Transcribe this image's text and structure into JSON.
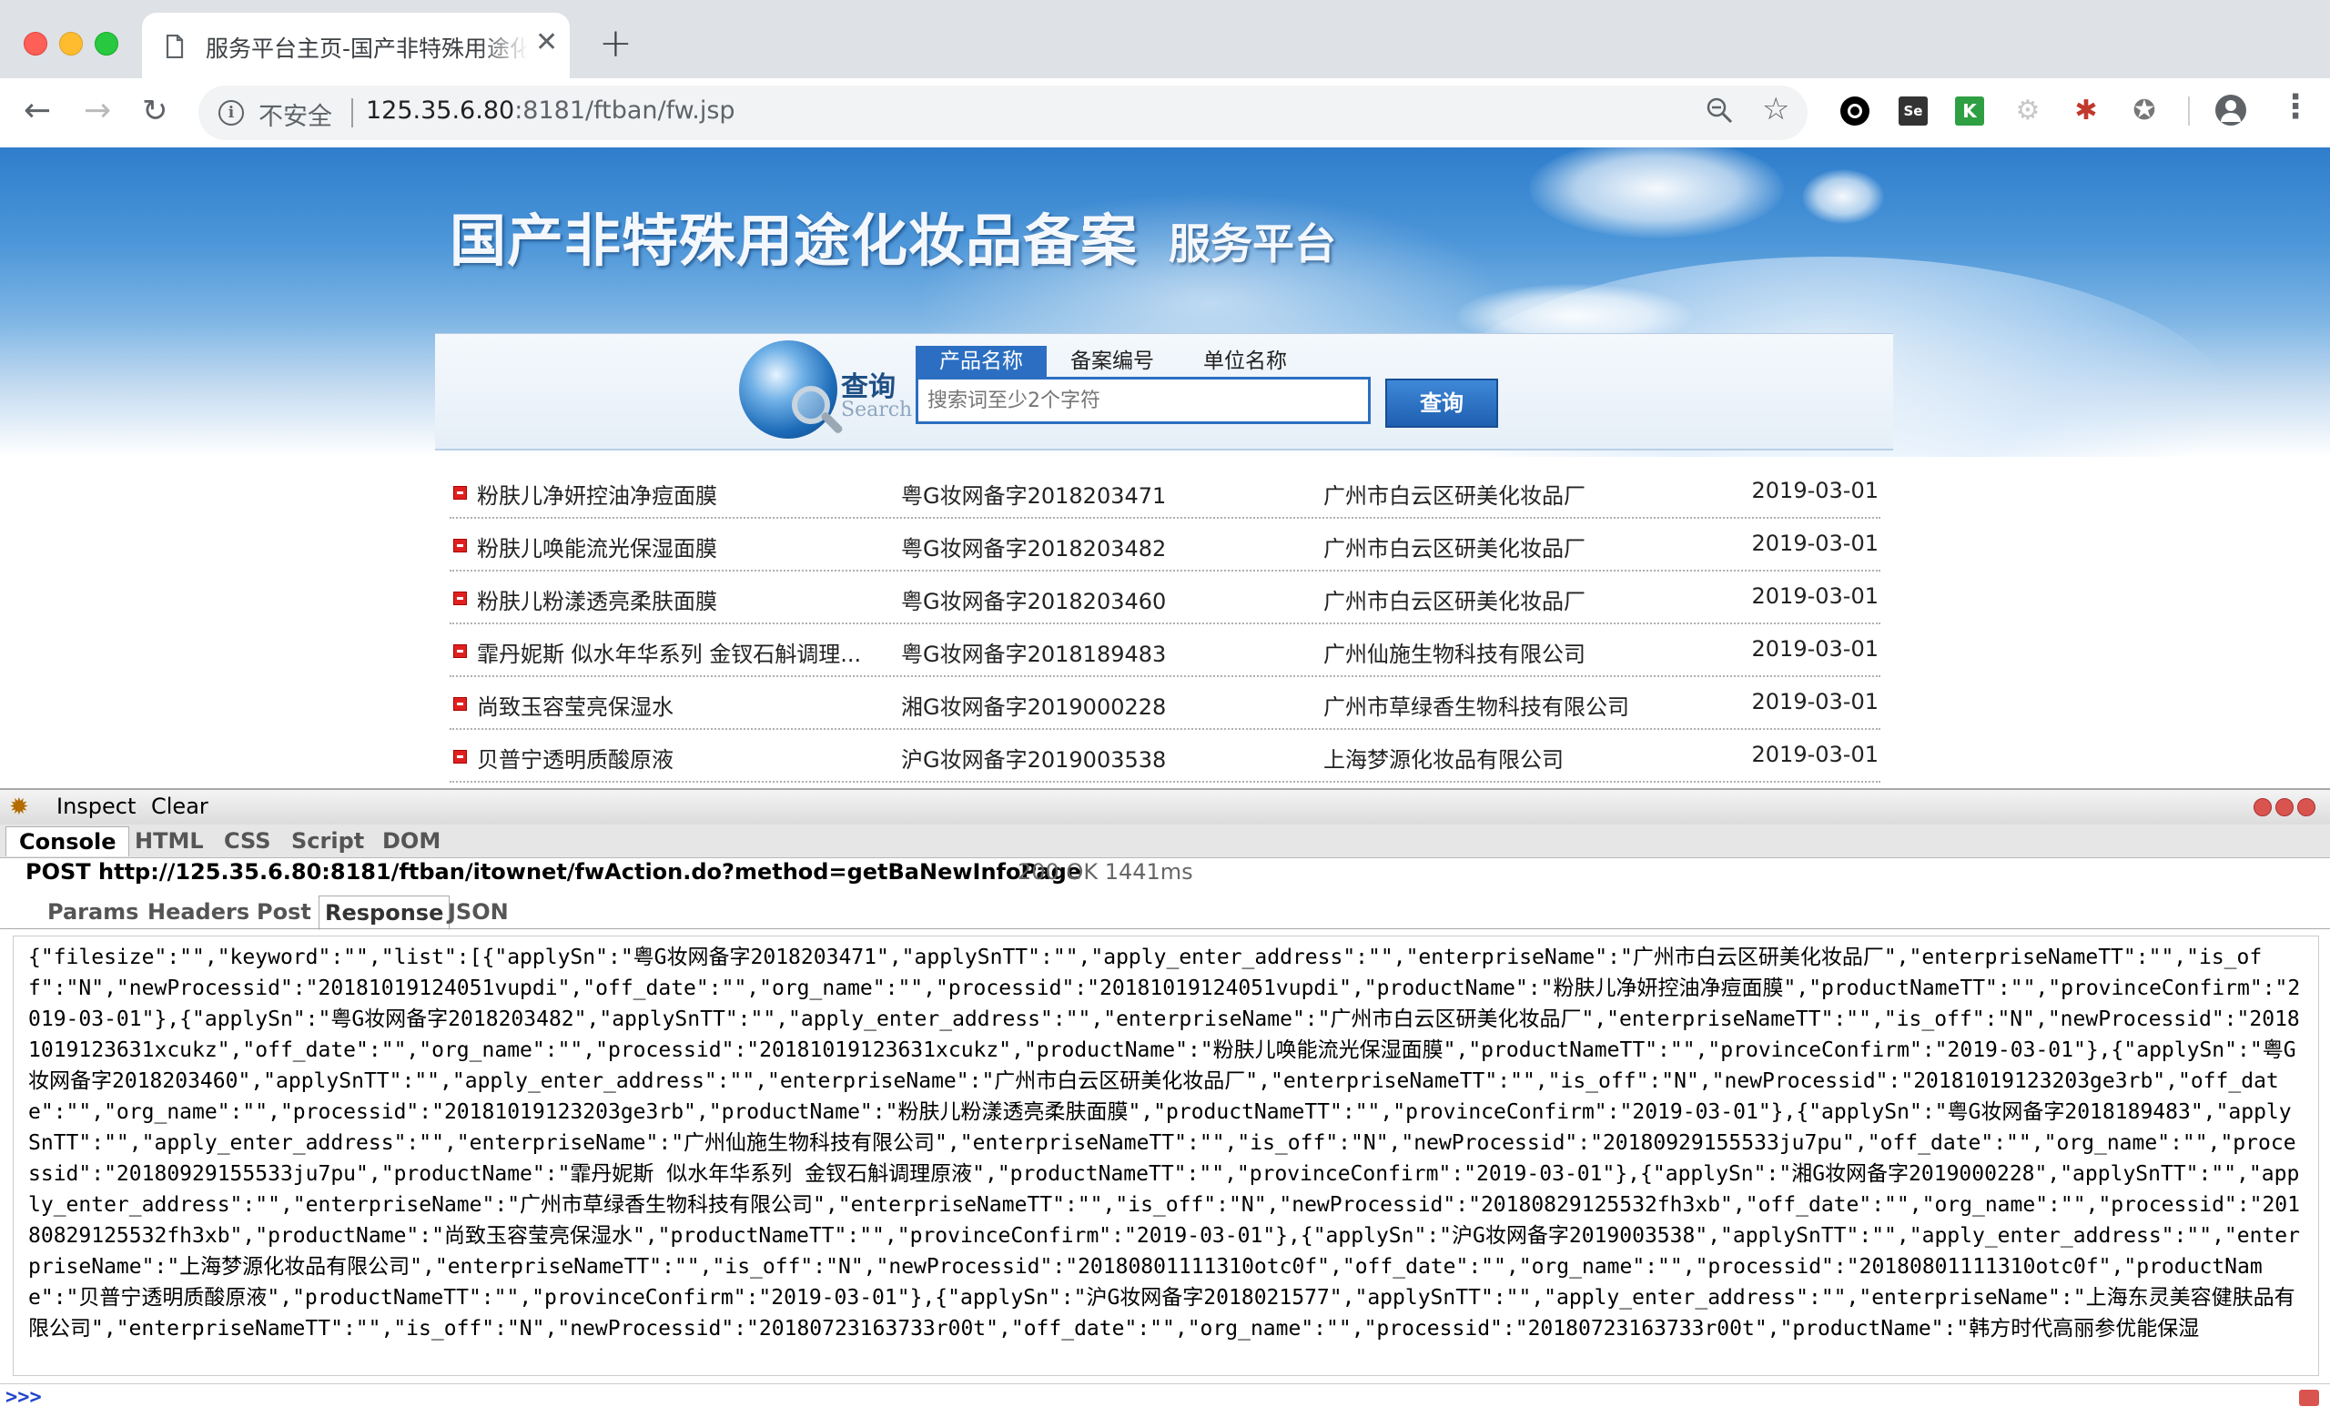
{
  "browser": {
    "tab_title": "服务平台主页-国产非特殊用途化妆品备案",
    "tab_close": "✕",
    "new_tab": "+",
    "insecure_label": "不安全",
    "url_host": "125.35.6.80",
    "url_rest": ":8181/ftban/fw.jsp",
    "extensions": [
      "circle-ext-icon",
      "selenium-ext-icon",
      "katalon-ext-icon",
      "gear-ext-icon",
      "bug-ext-icon",
      "film-ext-icon"
    ]
  },
  "banner": {
    "title": "国产非特殊用途化妆品备案",
    "subtitle": "服务平台"
  },
  "search": {
    "label_cn": "查询",
    "label_en": "Search",
    "tabs": [
      "产品名称",
      "备案编号",
      "单位名称"
    ],
    "placeholder": "搜索词至少2个字符",
    "button": "查询"
  },
  "records": [
    {
      "name": "粉肤儿净妍控油净痘面膜",
      "sn": "粤G妆网备字2018203471",
      "enterprise": "广州市白云区研美化妆品厂",
      "date": "2019-03-01"
    },
    {
      "name": "粉肤儿唤能流光保湿面膜",
      "sn": "粤G妆网备字2018203482",
      "enterprise": "广州市白云区研美化妆品厂",
      "date": "2019-03-01"
    },
    {
      "name": "粉肤儿粉漾透亮柔肤面膜",
      "sn": "粤G妆网备字2018203460",
      "enterprise": "广州市白云区研美化妆品厂",
      "date": "2019-03-01"
    },
    {
      "name": "霏丹妮斯 似水年华系列 金钗石斛调理...",
      "sn": "粤G妆网备字2018189483",
      "enterprise": "广州仙施生物科技有限公司",
      "date": "2019-03-01"
    },
    {
      "name": "尚致玉容莹亮保湿水",
      "sn": "湘G妆网备字2019000228",
      "enterprise": "广州市草绿香生物科技有限公司",
      "date": "2019-03-01"
    },
    {
      "name": "贝普宁透明质酸原液",
      "sn": "沪G妆网备字2019003538",
      "enterprise": "上海梦源化妆品有限公司",
      "date": "2019-03-01"
    }
  ],
  "firebug": {
    "inspect": "Inspect",
    "clear": "Clear",
    "tabs": [
      "Console",
      "HTML",
      "CSS",
      "Script",
      "DOM"
    ],
    "request": "POST http://125.35.6.80:8181/ftban/itownet/fwAction.do?method=getBaNewInfoPage",
    "status": "200 OK 1441ms",
    "sub_tabs": [
      "Params",
      "Headers",
      "Post",
      "Response",
      "JSON"
    ],
    "response": "{\"filesize\":\"\",\"keyword\":\"\",\"list\":[{\"applySn\":\"粤G妆网备字2018203471\",\"applySnTT\":\"\",\"apply_enter_address\":\"\",\"enterpriseName\":\"广州市白云区研美化妆品厂\",\"enterpriseNameTT\":\"\",\"is_off\":\"N\",\"newProcessid\":\"20181019124051vupdi\",\"off_date\":\"\",\"org_name\":\"\",\"processid\":\"20181019124051vupdi\",\"productName\":\"粉肤儿净妍控油净痘面膜\",\"productNameTT\":\"\",\"provinceConfirm\":\"2019-03-01\"},{\"applySn\":\"粤G妆网备字2018203482\",\"applySnTT\":\"\",\"apply_enter_address\":\"\",\"enterpriseName\":\"广州市白云区研美化妆品厂\",\"enterpriseNameTT\":\"\",\"is_off\":\"N\",\"newProcessid\":\"20181019123631xcukz\",\"off_date\":\"\",\"org_name\":\"\",\"processid\":\"20181019123631xcukz\",\"productName\":\"粉肤儿唤能流光保湿面膜\",\"productNameTT\":\"\",\"provinceConfirm\":\"2019-03-01\"},{\"applySn\":\"粤G妆网备字2018203460\",\"applySnTT\":\"\",\"apply_enter_address\":\"\",\"enterpriseName\":\"广州市白云区研美化妆品厂\",\"enterpriseNameTT\":\"\",\"is_off\":\"N\",\"newProcessid\":\"20181019123203ge3rb\",\"off_date\":\"\",\"org_name\":\"\",\"processid\":\"20181019123203ge3rb\",\"productName\":\"粉肤儿粉漾透亮柔肤面膜\",\"productNameTT\":\"\",\"provinceConfirm\":\"2019-03-01\"},{\"applySn\":\"粤G妆网备字2018189483\",\"applySnTT\":\"\",\"apply_enter_address\":\"\",\"enterpriseName\":\"广州仙施生物科技有限公司\",\"enterpriseNameTT\":\"\",\"is_off\":\"N\",\"newProcessid\":\"20180929155533ju7pu\",\"off_date\":\"\",\"org_name\":\"\",\"processid\":\"20180929155533ju7pu\",\"productName\":\"霏丹妮斯 似水年华系列 金钗石斛调理原液\",\"productNameTT\":\"\",\"provinceConfirm\":\"2019-03-01\"},{\"applySn\":\"湘G妆网备字2019000228\",\"applySnTT\":\"\",\"apply_enter_address\":\"\",\"enterpriseName\":\"广州市草绿香生物科技有限公司\",\"enterpriseNameTT\":\"\",\"is_off\":\"N\",\"newProcessid\":\"20180829125532fh3xb\",\"off_date\":\"\",\"org_name\":\"\",\"processid\":\"20180829125532fh3xb\",\"productName\":\"尚致玉容莹亮保湿水\",\"productNameTT\":\"\",\"provinceConfirm\":\"2019-03-01\"},{\"applySn\":\"沪G妆网备字2019003538\",\"applySnTT\":\"\",\"apply_enter_address\":\"\",\"enterpriseName\":\"上海梦源化妆品有限公司\",\"enterpriseNameTT\":\"\",\"is_off\":\"N\",\"newProcessid\":\"20180801111310otc0f\",\"off_date\":\"\",\"org_name\":\"\",\"processid\":\"20180801111310otc0f\",\"productName\":\"贝普宁透明质酸原液\",\"productNameTT\":\"\",\"provinceConfirm\":\"2019-03-01\"},{\"applySn\":\"沪G妆网备字2018021577\",\"applySnTT\":\"\",\"apply_enter_address\":\"\",\"enterpriseName\":\"上海东灵美容健肤品有限公司\",\"enterpriseNameTT\":\"\",\"is_off\":\"N\",\"newProcessid\":\"20180723163733r00t\",\"off_date\":\"\",\"org_name\":\"\",\"processid\":\"20180723163733r00t\",\"productName\":\"韩方时代高丽参优能保湿",
    "prompt": ">>>"
  }
}
